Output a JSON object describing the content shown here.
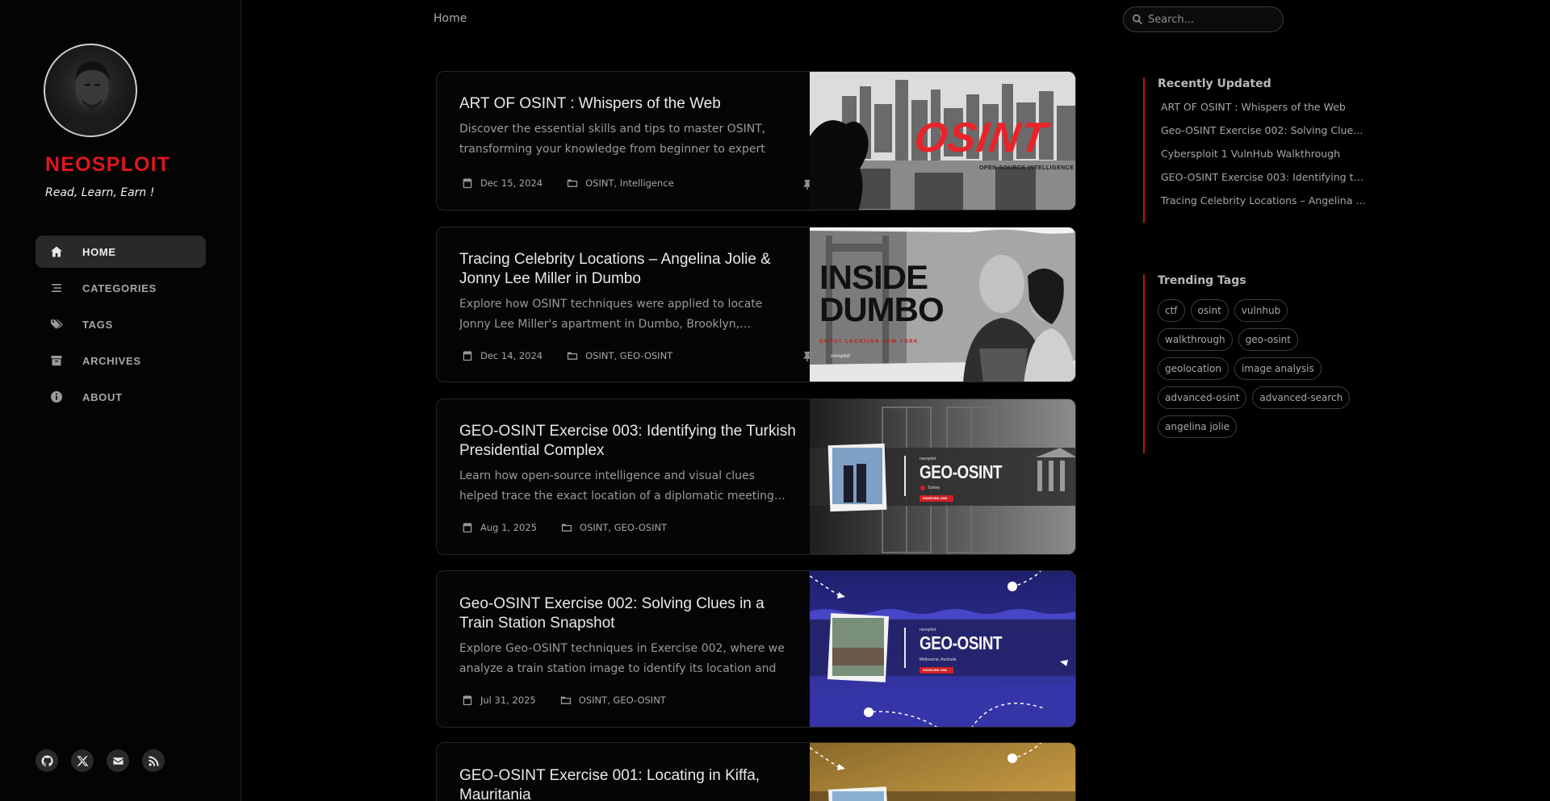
{
  "site": {
    "title": "NEOSPLOIT",
    "subtitle": "Read, Learn, Earn !"
  },
  "nav": [
    {
      "label": "HOME",
      "icon": "home-icon",
      "active": true
    },
    {
      "label": "CATEGORIES",
      "icon": "stream-icon",
      "active": false
    },
    {
      "label": "TAGS",
      "icon": "tags-icon",
      "active": false
    },
    {
      "label": "ARCHIVES",
      "icon": "archive-icon",
      "active": false
    },
    {
      "label": "ABOUT",
      "icon": "info-icon",
      "active": false
    }
  ],
  "social": [
    "github-icon",
    "x-twitter-icon",
    "email-icon",
    "rss-icon"
  ],
  "breadcrumb": "Home",
  "search": {
    "placeholder": "Search..."
  },
  "posts": [
    {
      "title": "ART OF OSINT : Whispers of the Web",
      "excerpt": "Discover the essential skills and tips to master OSINT, transforming your knowledge from beginner to expert wi…",
      "date": "Dec 15, 2024",
      "categories": "OSINT, Intelligence",
      "pinned": true,
      "thumb_text": "OSINT",
      "thumb_sub": "OPEN-SOURCE INTELLIGENCE"
    },
    {
      "title": "Tracing Celebrity Locations – Angelina Jolie & Jonny Lee Miller in Dumbo",
      "excerpt": "Explore how OSINT techniques were applied to locate Jonny Lee Miller's apartment in Dumbo, Brooklyn,…",
      "date": "Dec 14, 2024",
      "categories": "OSINT, GEO-OSINT",
      "pinned": true,
      "thumb_text": "INSIDE DUMBO",
      "thumb_sub": "GHOST LOCATION NEW YORK",
      "thumb_mini": "neosploit"
    },
    {
      "title": "GEO-OSINT Exercise 003: Identifying the Turkish Presidential Complex",
      "excerpt": "Learn how open-source intelligence and visual clues helped trace the exact location of a diplomatic meeting…",
      "date": "Aug 1, 2025",
      "categories": "OSINT, GEO-OSINT",
      "pinned": false,
      "thumb_text": "GEO-OSINT",
      "thumb_brand": "neosploit",
      "thumb_sub": "Turkey",
      "thumb_btn": "EXERCISE #003"
    },
    {
      "title": "Geo-OSINT Exercise 002: Solving Clues in a Train Station Snapshot",
      "excerpt": "Explore Geo-OSINT techniques in Exercise 002, where we analyze a train station image to identify its location and t…",
      "date": "Jul 31, 2025",
      "categories": "OSINT, GEO-OSINT",
      "pinned": false,
      "thumb_text": "GEO-OSINT",
      "thumb_brand": "neosploit",
      "thumb_sub": "Melbourne, Australia",
      "thumb_btn": "EXERCISE #002"
    },
    {
      "title": "GEO-OSINT Exercise 001: Locating in Kiffa, Mauritania",
      "excerpt": "",
      "date": "",
      "categories": "",
      "pinned": false
    }
  ],
  "recently_updated": {
    "title": "Recently Updated",
    "items": [
      "ART OF OSINT : Whispers of the Web",
      "Geo-OSINT Exercise 002: Solving Clues in…",
      "Cybersploit 1 VulnHub Walkthrough",
      "GEO-OSINT Exercise 003: Identifying the …",
      "Tracing Celebrity Locations – Angelina J…"
    ]
  },
  "trending_tags": {
    "title": "Trending Tags",
    "items": [
      "ctf",
      "osint",
      "vulnhub",
      "walkthrough",
      "geo-osint",
      "geolocation",
      "image analysis",
      "advanced-osint",
      "advanced-search",
      "angelina jolie"
    ]
  },
  "colors": {
    "accent": "#e0161c",
    "background": "#000000",
    "card_bg": "#050505"
  }
}
